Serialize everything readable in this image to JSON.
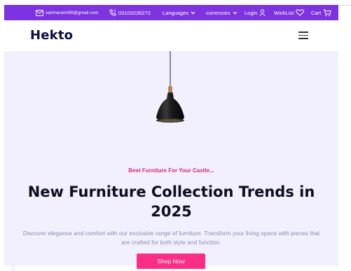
{
  "topbar": {
    "email": "sarimaraim99@gmail.com",
    "phone": "03103236272",
    "languages_label": "Languages",
    "currencies_label": "currencies",
    "login_label": "Login",
    "wishlist_label": "WishList",
    "cart_label": "Cart",
    "icons": [
      "mail-icon",
      "phone-icon",
      "chevron-down-icon",
      "user-icon",
      "heart-icon",
      "cart-icon"
    ]
  },
  "navbar": {
    "logo": "Hekto",
    "menu_icon": "hamburger-icon"
  },
  "hero": {
    "tagline": "Best Furniture For Your Castle...",
    "headline": "New Furniture Collection Trends in 2025",
    "description": "Discover elegance and comfort with our exclusive range of furniture. Transform your living space with pieces that are crafted for both style and function.",
    "cta_label": "Shop Now"
  },
  "colors": {
    "topbar_bg": "#7e33e0",
    "hero_bg": "#f2f0ff",
    "accent_pink": "#fb2e86",
    "tagline_pink": "#d5287f",
    "logo_navy": "#0d0e43"
  }
}
